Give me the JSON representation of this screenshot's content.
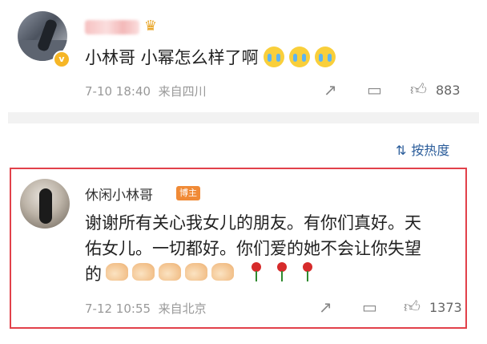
{
  "comment1": {
    "text": "小林哥 小幂怎么样了啊",
    "emoji": [
      "crying-face",
      "crying-face",
      "crying-face"
    ],
    "time": "7-10 18:40",
    "location": "来自四川",
    "likes": "883"
  },
  "sort": {
    "label": "按热度"
  },
  "reply": {
    "name": "休闲小林哥",
    "badge": "博主",
    "lines": [
      "谢谢所有关心我女儿的朋友。有你们真好。天",
      "佑女儿。一切都好。你们爱的她不会让你失望",
      "的"
    ],
    "emoji": [
      "palms-together",
      "palms-together",
      "palms-together",
      "palms-together",
      "palms-together",
      "rose",
      "rose",
      "rose"
    ],
    "time": "7-12 10:55",
    "location": "来自北京",
    "likes": "1373"
  },
  "colors": {
    "highlight_border": "#e2414a",
    "link_blue": "#2a5c9a",
    "badge_orange": "#f08a36",
    "meta_gray": "#999999"
  }
}
